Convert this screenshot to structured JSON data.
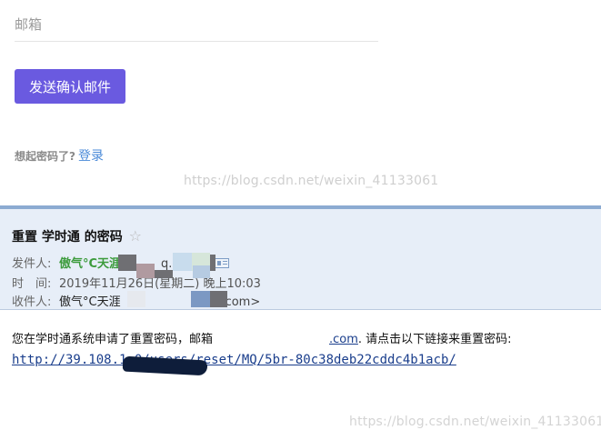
{
  "form": {
    "email_placeholder": "邮箱",
    "send_button_label": "发送确认邮件",
    "forgot_prompt": "想起密码了?",
    "login_link": "登录"
  },
  "watermarks": {
    "top": "https://blog.csdn.net/weixin_41133061",
    "bottom": "https://blog.csdn.net/weixin_41133061"
  },
  "mail": {
    "subject": "重置 学时通 的密码",
    "star_icon": "☆",
    "from_label": "发件人:",
    "from_name": "傲气°C天涯",
    "from_addr_tail": "q.com>",
    "time_label": "时　间:",
    "time_value": "2019年11月26日(星期二) 晚上10:03",
    "to_label": "收件人:",
    "to_name": "傲气°C天涯",
    "to_addr_tail": "com>",
    "body_text": "您在学时通系统申请了重置密码，邮箱",
    "body_domain": ".com",
    "body_after": ". 请点击以下链接来重置密码:",
    "reset_link": "http://39.108.1          0/users/reset/MQ/5br-80c38deb22cddc4b1acb/"
  },
  "colors": {
    "accent": "#6a5ae0",
    "link": "#4a8ad8",
    "sender_green": "#3c9b3c",
    "header_bg": "#e7eef8"
  }
}
